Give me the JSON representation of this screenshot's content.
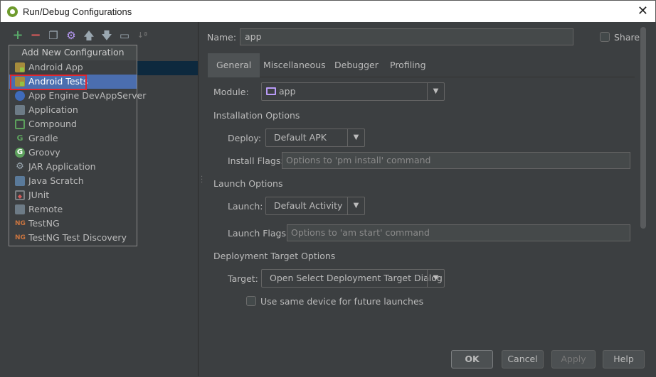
{
  "window": {
    "title": "Run/Debug Configurations",
    "close_glyph": "✕"
  },
  "popup": {
    "header": "Add New Configuration",
    "items": [
      {
        "label": "Android App",
        "icon": "android-app-icon"
      },
      {
        "label": "Android Tests",
        "icon": "android-tests-icon",
        "selected": true
      },
      {
        "label": "App Engine DevAppServer",
        "icon": "app-engine-icon"
      },
      {
        "label": "Application",
        "icon": "application-icon"
      },
      {
        "label": "Compound",
        "icon": "compound-icon"
      },
      {
        "label": "Gradle",
        "icon": "gradle-icon"
      },
      {
        "label": "Groovy",
        "icon": "groovy-icon"
      },
      {
        "label": "JAR Application",
        "icon": "jar-icon"
      },
      {
        "label": "Java Scratch",
        "icon": "java-scratch-icon"
      },
      {
        "label": "JUnit",
        "icon": "junit-icon"
      },
      {
        "label": "Remote",
        "icon": "remote-icon"
      },
      {
        "label": "TestNG",
        "icon": "testng-icon"
      },
      {
        "label": "TestNG Test Discovery",
        "icon": "testng-icon"
      }
    ]
  },
  "form": {
    "name_label": "Name:",
    "name_value": "app",
    "share_label": "Share",
    "tabs": [
      "General",
      "Miscellaneous",
      "Debugger",
      "Profiling"
    ],
    "module_label": "Module:",
    "module_value": "app",
    "installation_section": "Installation Options",
    "deploy_label": "Deploy:",
    "deploy_value": "Default APK",
    "install_flags_label": "Install Flags:",
    "install_flags_placeholder": "Options to 'pm install' command",
    "launch_section": "Launch Options",
    "launch_label": "Launch:",
    "launch_value": "Default Activity",
    "launch_flags_label": "Launch Flags:",
    "launch_flags_placeholder": "Options to 'am start' command",
    "deployment_section": "Deployment Target Options",
    "target_label": "Target:",
    "target_value": "Open Select Deployment Target Dialog",
    "same_device_label": "Use same device for future launches"
  },
  "buttons": {
    "ok": "OK",
    "cancel": "Cancel",
    "apply": "Apply",
    "help": "Help"
  },
  "colors": {
    "background": "#3c3f41",
    "selection": "#4b6eaf",
    "highlight_box": "#e0262f",
    "add_icon": "#59a869",
    "remove_icon": "#d75a5a"
  }
}
